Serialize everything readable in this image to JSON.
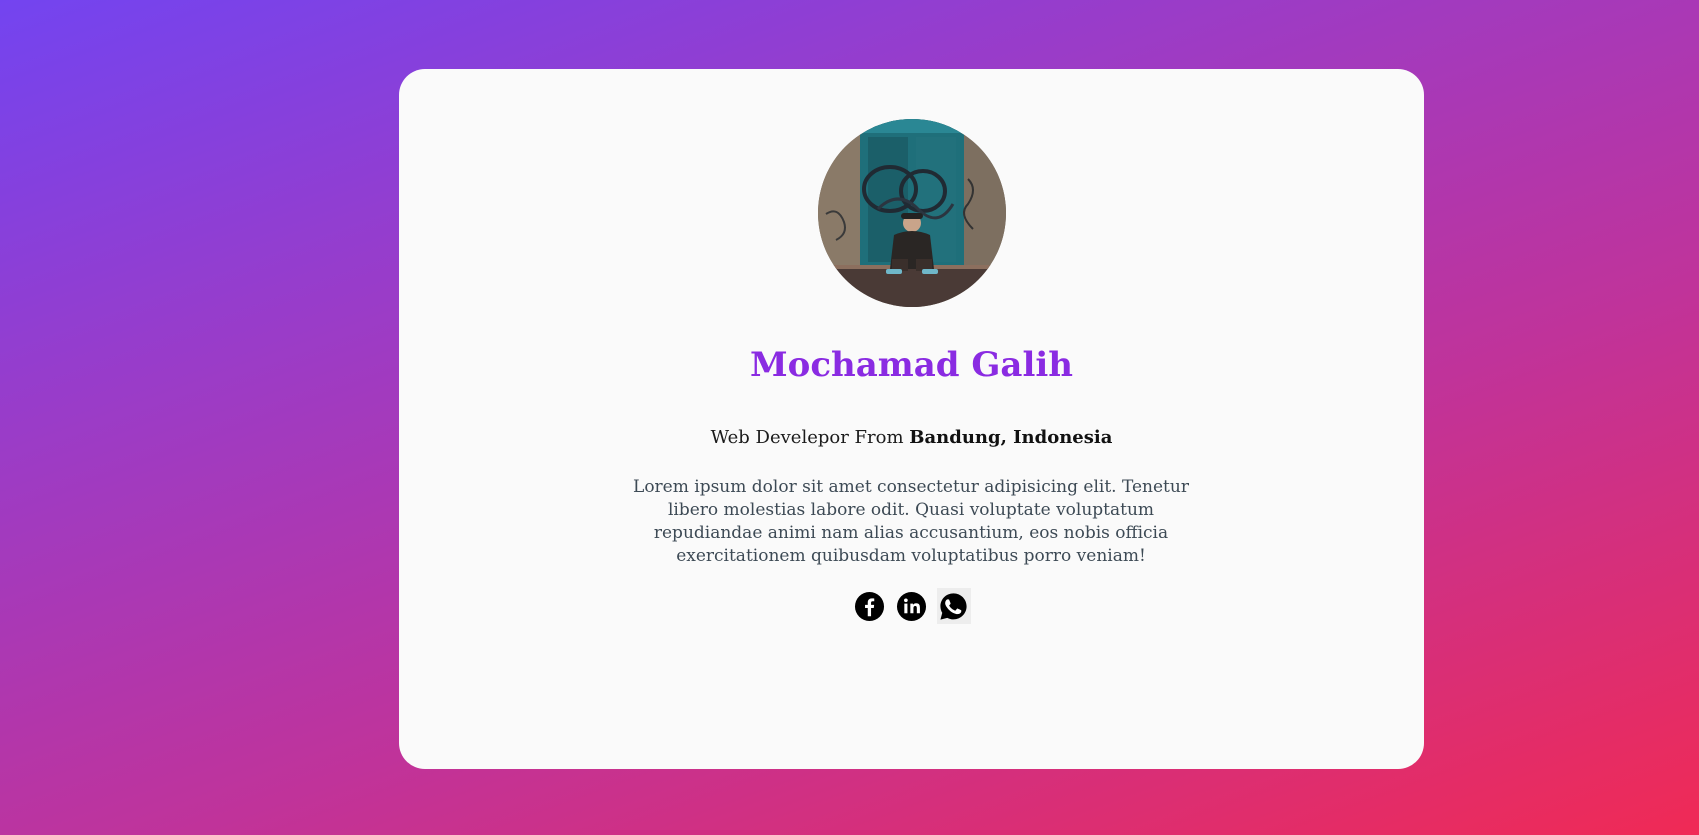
{
  "profile": {
    "name": "Mochamad Galih",
    "tagline_prefix": "Web Develepor From ",
    "tagline_location": "Bandung, Indonesia",
    "bio": "Lorem ipsum dolor sit amet consectetur adipisicing elit. Tenetur libero molestias labore odit. Quasi voluptate voluptatum repudiandae animi nam alias accusantium, eos nobis officia exercitationem quibusdam voluptatibus porro veniam!"
  },
  "socials": [
    {
      "icon": "facebook-icon"
    },
    {
      "icon": "linkedin-icon"
    },
    {
      "icon": "whatsapp-icon"
    }
  ],
  "colors": {
    "accent": "#8a2be2",
    "card_background": "#fafafa",
    "gradient_start": "#7344f0",
    "gradient_end": "#f02a55"
  }
}
